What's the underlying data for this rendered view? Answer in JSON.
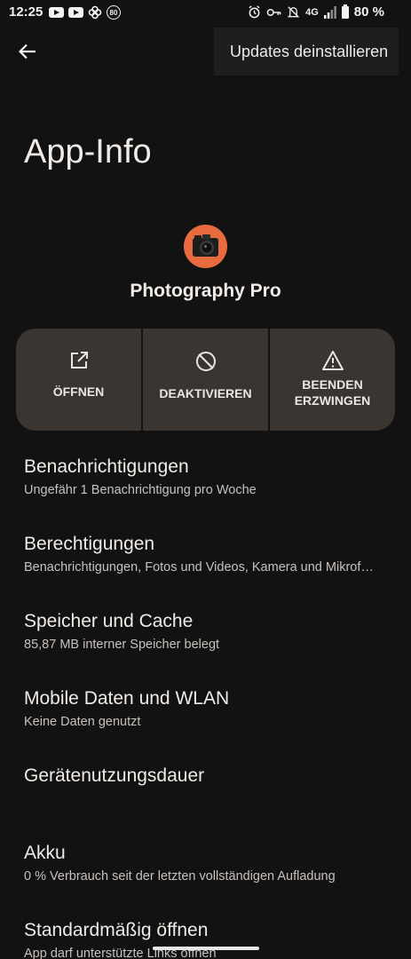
{
  "status_bar": {
    "time": "12:25",
    "left_icons": [
      "youtube-icon",
      "youtube-icon",
      "pinwheel-icon",
      "badge-80-icon"
    ],
    "badge_text": "80",
    "right_icons": [
      "alarm-icon",
      "key-icon",
      "mute-icon",
      "signal-icon"
    ],
    "network": "4G",
    "battery": "80 %"
  },
  "header": {
    "back_icon": "arrow-left-icon",
    "menu_item": "Updates deinstallieren"
  },
  "page_title": "App-Info",
  "app": {
    "name": "Photography Pro",
    "icon": "camera-icon",
    "icon_color": "#e86b40"
  },
  "actions": [
    {
      "label": "ÖFFNEN",
      "icon": "open-external-icon"
    },
    {
      "label": "DEAKTIVIEREN",
      "icon": "disable-icon"
    },
    {
      "label_line1": "BEENDEN",
      "label_line2": "ERZWINGEN",
      "icon": "warning-icon"
    }
  ],
  "list": [
    {
      "title": "Benachrichtigungen",
      "subtitle": "Ungefähr 1 Benachrichtigung pro Woche"
    },
    {
      "title": "Berechtigungen",
      "subtitle": "Benachrichtigungen, Fotos und Videos, Kamera und Mikrof…"
    },
    {
      "title": "Speicher und Cache",
      "subtitle": "85,87 MB interner Speicher belegt"
    },
    {
      "title": "Mobile Daten und WLAN",
      "subtitle": "Keine Daten genutzt"
    },
    {
      "title": "Gerätenutzungsdauer"
    },
    {
      "title": "Akku",
      "subtitle": "0 % Verbrauch seit der letzten vollständigen Aufladung"
    },
    {
      "title": "Standardmäßig öffnen",
      "subtitle": "App darf unterstützte Links öffnen"
    }
  ],
  "colors": {
    "background": "#121212",
    "button_group": "#3b3532",
    "text_primary": "#f0ebe6",
    "text_secondary": "#c8c1bc"
  }
}
